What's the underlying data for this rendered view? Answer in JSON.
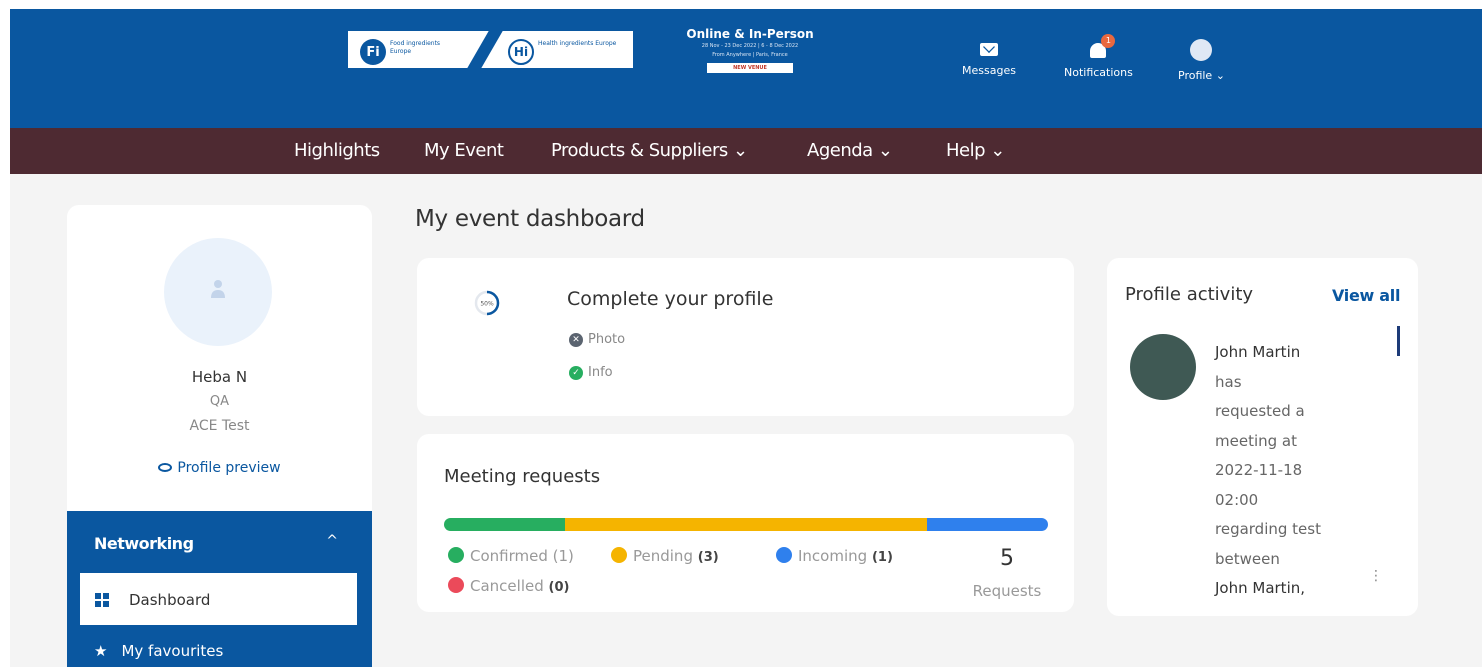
{
  "header": {
    "logo_fi_text": "Food ingredients Europe",
    "logo_hi_text": "Health ingredients Europe",
    "promo_title": "Online & In-Person",
    "promo_dates": "28 Nov - 23 Dec 2022 | 6 - 8 Dec 2022",
    "promo_places": "From Anywhere | Paris, France",
    "promo_ribbon": "NEW VENUE",
    "messages_label": "Messages",
    "notifications_label": "Notifications",
    "notifications_count": "1",
    "profile_label": "Profile ⌄"
  },
  "nav": {
    "items": [
      "Highlights",
      "My Event",
      "Products & Suppliers ⌄",
      "Agenda ⌄",
      "Help ⌄"
    ]
  },
  "sidebar": {
    "user_name": "Heba N",
    "user_role": "QA",
    "user_company": "ACE Test",
    "profile_preview": "Profile preview",
    "section_title": "Networking",
    "section_chevron": "^",
    "items": [
      "Dashboard",
      "My favourites"
    ]
  },
  "dashboard": {
    "title": "My event dashboard",
    "profile_card": {
      "progress_label": "50%",
      "title": "Complete your profile",
      "photo_label": "Photo",
      "info_label": "Info"
    },
    "meetings": {
      "title": "Meeting requests",
      "confirmed_label": "Confirmed (1)",
      "pending_label": "Pending",
      "pending_count": "(3)",
      "incoming_label": "Incoming",
      "incoming_count": "(1)",
      "cancelled_label": "Cancelled",
      "cancelled_count": "(0)",
      "total": "5",
      "total_label": "Requests"
    },
    "activity": {
      "title": "Profile activity",
      "view_all": "View all",
      "entry_name": "John Martin",
      "entry_line1": "has",
      "entry_line2": "requested a",
      "entry_line3": "meeting at",
      "entry_line4": "2022-11-18",
      "entry_line5": "02:00",
      "entry_line6": "regarding test",
      "entry_line7": "between",
      "entry_line8": "John Martin,"
    }
  },
  "colors": {
    "header_blue": "#0a57a0",
    "nav_maroon": "#4e2a32",
    "confirmed": "#27ae60",
    "pending": "#f5b400",
    "incoming": "#2f80ed",
    "cancelled": "#eb4a5a"
  }
}
